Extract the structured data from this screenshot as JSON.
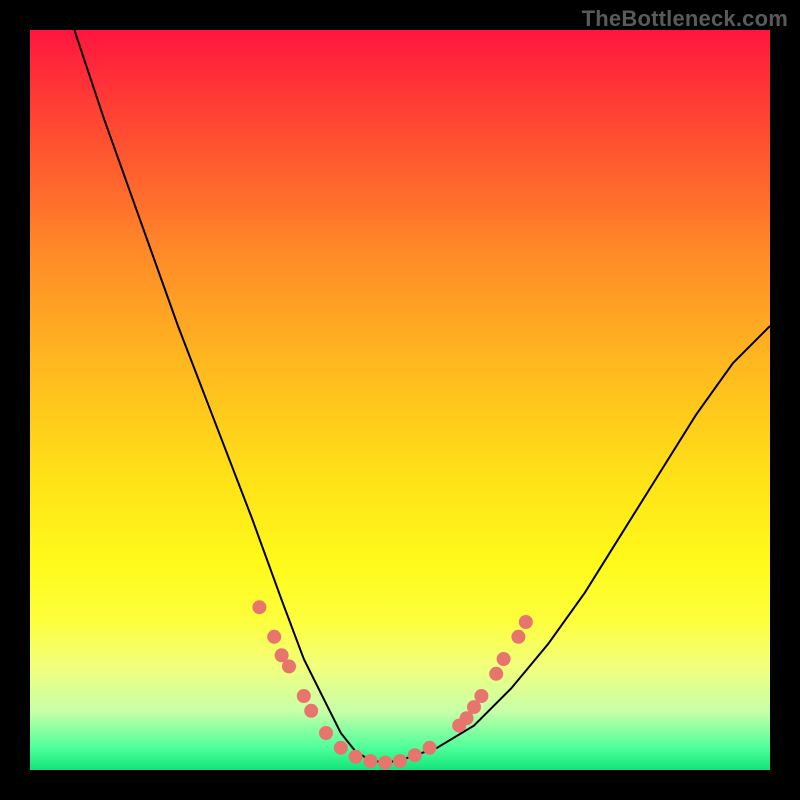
{
  "watermark": "TheBottleneck.com",
  "chart_data": {
    "type": "line",
    "title": "",
    "xlabel": "",
    "ylabel": "",
    "xlim": [
      0,
      100
    ],
    "ylim": [
      0,
      100
    ],
    "grid": false,
    "legend": false,
    "series": [
      {
        "name": "curve",
        "x": [
          6,
          10,
          15,
          20,
          25,
          30,
          34,
          37,
          40,
          42,
          44,
          46,
          48,
          50,
          55,
          60,
          65,
          70,
          75,
          80,
          85,
          90,
          95,
          100
        ],
        "y": [
          100,
          88,
          74,
          60,
          47,
          34,
          23,
          15,
          9,
          5,
          2.5,
          1.3,
          1,
          1.3,
          3,
          6,
          11,
          17,
          24,
          32,
          40,
          48,
          55,
          60
        ]
      }
    ],
    "markers": [
      {
        "x": 31,
        "y": 22
      },
      {
        "x": 33,
        "y": 18
      },
      {
        "x": 34,
        "y": 15.5
      },
      {
        "x": 35,
        "y": 14
      },
      {
        "x": 37,
        "y": 10
      },
      {
        "x": 38,
        "y": 8
      },
      {
        "x": 40,
        "y": 5
      },
      {
        "x": 42,
        "y": 3
      },
      {
        "x": 44,
        "y": 1.8
      },
      {
        "x": 46,
        "y": 1.2
      },
      {
        "x": 48,
        "y": 1
      },
      {
        "x": 50,
        "y": 1.2
      },
      {
        "x": 52,
        "y": 2
      },
      {
        "x": 54,
        "y": 3
      },
      {
        "x": 58,
        "y": 6
      },
      {
        "x": 59,
        "y": 7
      },
      {
        "x": 60,
        "y": 8.5
      },
      {
        "x": 61,
        "y": 10
      },
      {
        "x": 63,
        "y": 13
      },
      {
        "x": 64,
        "y": 15
      },
      {
        "x": 66,
        "y": 18
      },
      {
        "x": 67,
        "y": 20
      }
    ],
    "colors": {
      "curve_stroke": "#000000",
      "marker_fill": "#e8746e"
    }
  }
}
